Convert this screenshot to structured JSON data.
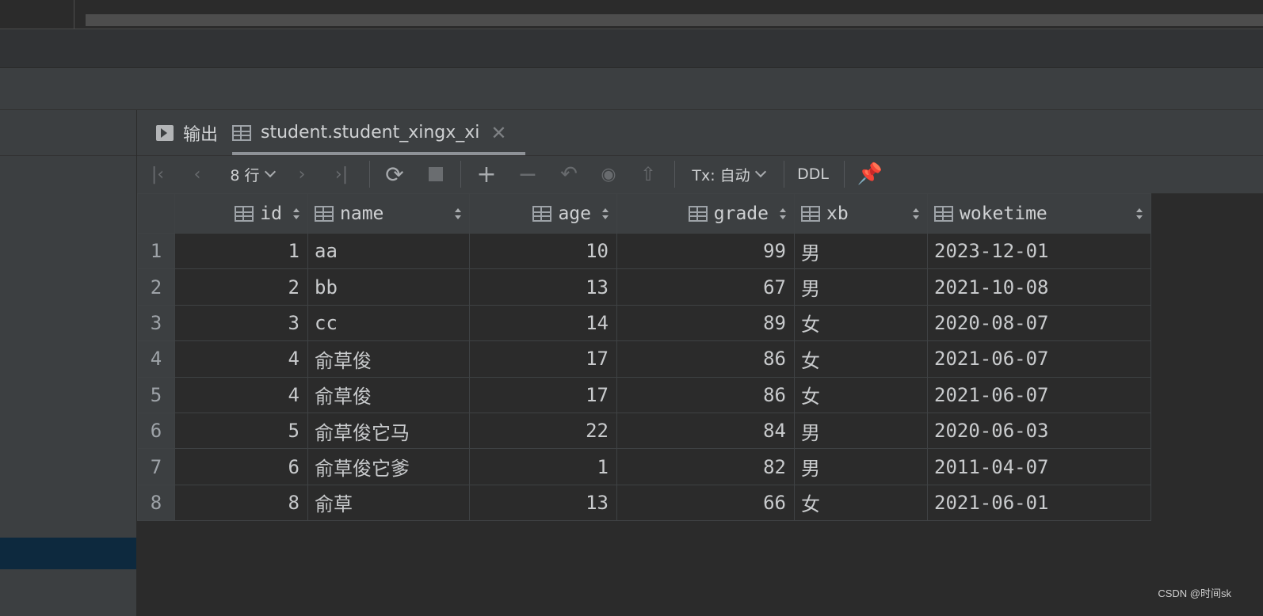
{
  "tabs": {
    "output_label": "输出",
    "table_label": "student.student_xingx_xi",
    "close_glyph": "✕"
  },
  "toolbar": {
    "rows_label": "8 行",
    "tx_label": "Tx: 自动",
    "ddl_label": "DDL"
  },
  "grid": {
    "columns": [
      "id",
      "name",
      "age",
      "grade",
      "xb",
      "woketime"
    ],
    "rows": [
      {
        "n": "1",
        "id": "1",
        "name": "aa",
        "age": "10",
        "grade": "99",
        "xb": "男",
        "woketime": "2023-12-01"
      },
      {
        "n": "2",
        "id": "2",
        "name": "bb",
        "age": "13",
        "grade": "67",
        "xb": "男",
        "woketime": "2021-10-08"
      },
      {
        "n": "3",
        "id": "3",
        "name": "cc",
        "age": "14",
        "grade": "89",
        "xb": "女",
        "woketime": "2020-08-07"
      },
      {
        "n": "4",
        "id": "4",
        "name": "俞草俊",
        "age": "17",
        "grade": "86",
        "xb": "女",
        "woketime": "2021-06-07"
      },
      {
        "n": "5",
        "id": "4",
        "name": "俞草俊",
        "age": "17",
        "grade": "86",
        "xb": "女",
        "woketime": "2021-06-07"
      },
      {
        "n": "6",
        "id": "5",
        "name": "俞草俊它马",
        "age": "22",
        "grade": "84",
        "xb": "男",
        "woketime": "2020-06-03"
      },
      {
        "n": "7",
        "id": "6",
        "name": "俞草俊它爹",
        "age": "1",
        "grade": "82",
        "xb": "男",
        "woketime": "2011-04-07"
      },
      {
        "n": "8",
        "id": "8",
        "name": "俞草",
        "age": "13",
        "grade": "66",
        "xb": "女",
        "woketime": "2021-06-01"
      }
    ]
  },
  "watermark": "CSDN @时间sk"
}
